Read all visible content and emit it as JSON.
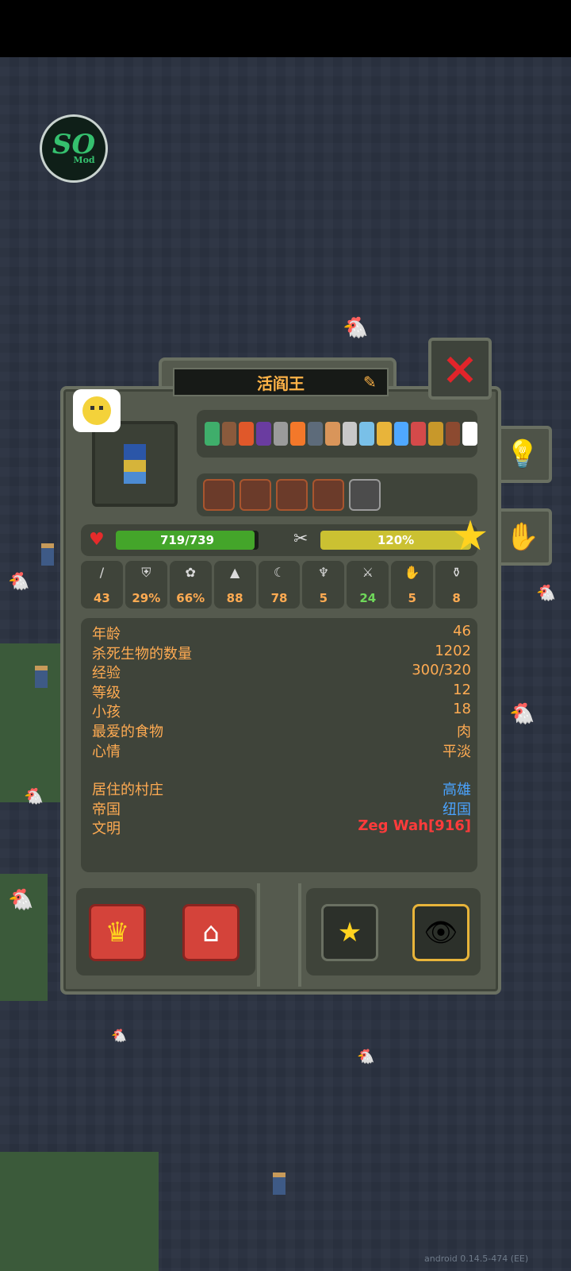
{
  "app": {
    "version": "android 0.14.5-474 (EE)",
    "mod_logo_text": "SO",
    "mod_logo_sub": "Mod"
  },
  "unit": {
    "name": "活阎王",
    "health": {
      "text": "719/739",
      "current": 719,
      "max": 739
    },
    "hunger": {
      "text": "120%",
      "percent": 120
    },
    "stats": [
      {
        "icon": "sword-icon",
        "value": "43",
        "color": "#ffab52"
      },
      {
        "icon": "shield-icon",
        "value": "29%",
        "color": "#ffab52"
      },
      {
        "icon": "flower-icon",
        "value": "66%",
        "color": "#ffab52"
      },
      {
        "icon": "boot-icon",
        "value": "88",
        "color": "#ffab52"
      },
      {
        "icon": "scythe-icon",
        "value": "78",
        "color": "#ffab52"
      },
      {
        "icon": "wings-icon",
        "value": "5",
        "color": "#ffab52"
      },
      {
        "icon": "crossed-swords-icon",
        "value": "24",
        "color": "#6fd85a"
      },
      {
        "icon": "hand-icon",
        "value": "5",
        "color": "#ffab52"
      },
      {
        "icon": "potion-icon",
        "value": "8",
        "color": "#ffab52"
      }
    ],
    "info": [
      {
        "key": "年龄",
        "value": "46",
        "color": "#ffab52"
      },
      {
        "key": "杀死生物的数量",
        "value": "1202",
        "color": "#ffab52"
      },
      {
        "key": "经验",
        "value": "300/320",
        "color": "#ffab52"
      },
      {
        "key": "等级",
        "value": "12",
        "color": "#ffab52"
      },
      {
        "key": "小孩",
        "value": "18",
        "color": "#ffab52"
      },
      {
        "key": "最爱的食物",
        "value": "肉",
        "color": "#ffab52"
      },
      {
        "key": "心情",
        "value": "平淡",
        "color": "#ffab52"
      }
    ],
    "info2": [
      {
        "key": "居住的村庄",
        "value": "高雄",
        "color": "#4aa3ff"
      },
      {
        "key": "帝国",
        "value": "纽国",
        "color": "#4aa3ff"
      },
      {
        "key": "文明",
        "value": "Zeg Wah[916]",
        "color": "#ff3b3b"
      }
    ]
  },
  "icons": {
    "close": "×",
    "edit": "✎",
    "heart": "♥",
    "tools": "✂",
    "star": "★",
    "lightbulb": "💡",
    "hand": "✋",
    "crown": "♛",
    "village": "⌂",
    "favorite": "★",
    "eye": "👁"
  },
  "colors": {
    "accent": "#ffab52",
    "hp": "#44a52a",
    "hunger": "#cbc132",
    "close": "#e2242a"
  }
}
